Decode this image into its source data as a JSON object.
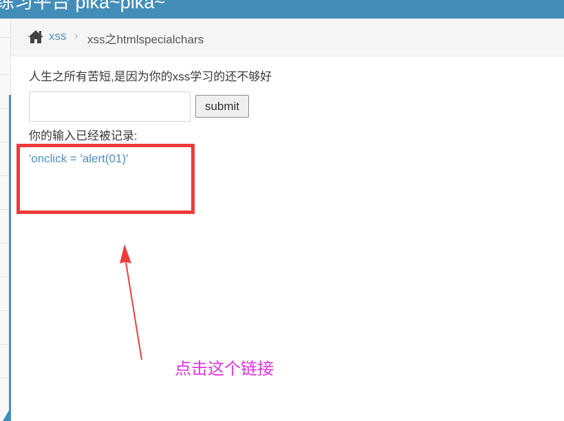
{
  "header": {
    "title": "练习平台 pika~pika~"
  },
  "breadcrumb": {
    "home_icon": "home-icon",
    "section": "xss",
    "separator": "›",
    "current": "xss之htmlspecialchars"
  },
  "main": {
    "intro": "人生之所有苦短,是因为你的xss学习的还不够好",
    "input": {
      "value": "",
      "placeholder": ""
    },
    "submit_label": "submit",
    "logged_label": "你的输入已经被记录:",
    "result_link": "'onclick = 'alert(01)'"
  },
  "annotation": {
    "text": "点击这个链接",
    "box_color": "#f03a3a",
    "arrow_color": "#f03a3a",
    "text_color": "#e033e6"
  },
  "colors": {
    "navbar": "#438eb9",
    "link": "#4c8fbd"
  }
}
